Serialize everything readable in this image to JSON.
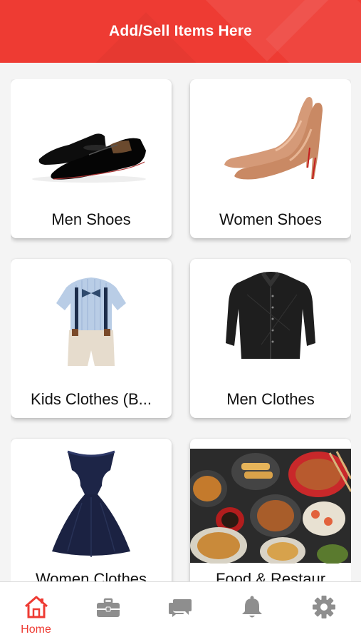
{
  "header": {
    "title": "Add/Sell Items Here",
    "color": "#ee3b33"
  },
  "categories": [
    {
      "label": "Men Shoes",
      "icon": "men-shoes-image"
    },
    {
      "label": "Women Shoes",
      "icon": "women-shoes-image"
    },
    {
      "label": "Kids Clothes (Boys)",
      "display_label": "Kids Clothes (B...",
      "icon": "kids-clothes-image"
    },
    {
      "label": "Men Clothes",
      "icon": "men-clothes-image"
    },
    {
      "label": "Women Clothes",
      "icon": "women-dress-image"
    },
    {
      "label": "Food & Restaur",
      "icon": "food-image"
    }
  ],
  "tabbar": {
    "active_color": "#ee3b33",
    "inactive_color": "#8e8e8e",
    "tabs": [
      {
        "label": "Home",
        "icon": "home-icon",
        "active": true
      },
      {
        "label": "",
        "icon": "briefcase-icon",
        "active": false
      },
      {
        "label": "",
        "icon": "chat-icon",
        "active": false
      },
      {
        "label": "",
        "icon": "bell-icon",
        "active": false
      },
      {
        "label": "",
        "icon": "gear-icon",
        "active": false
      }
    ]
  }
}
